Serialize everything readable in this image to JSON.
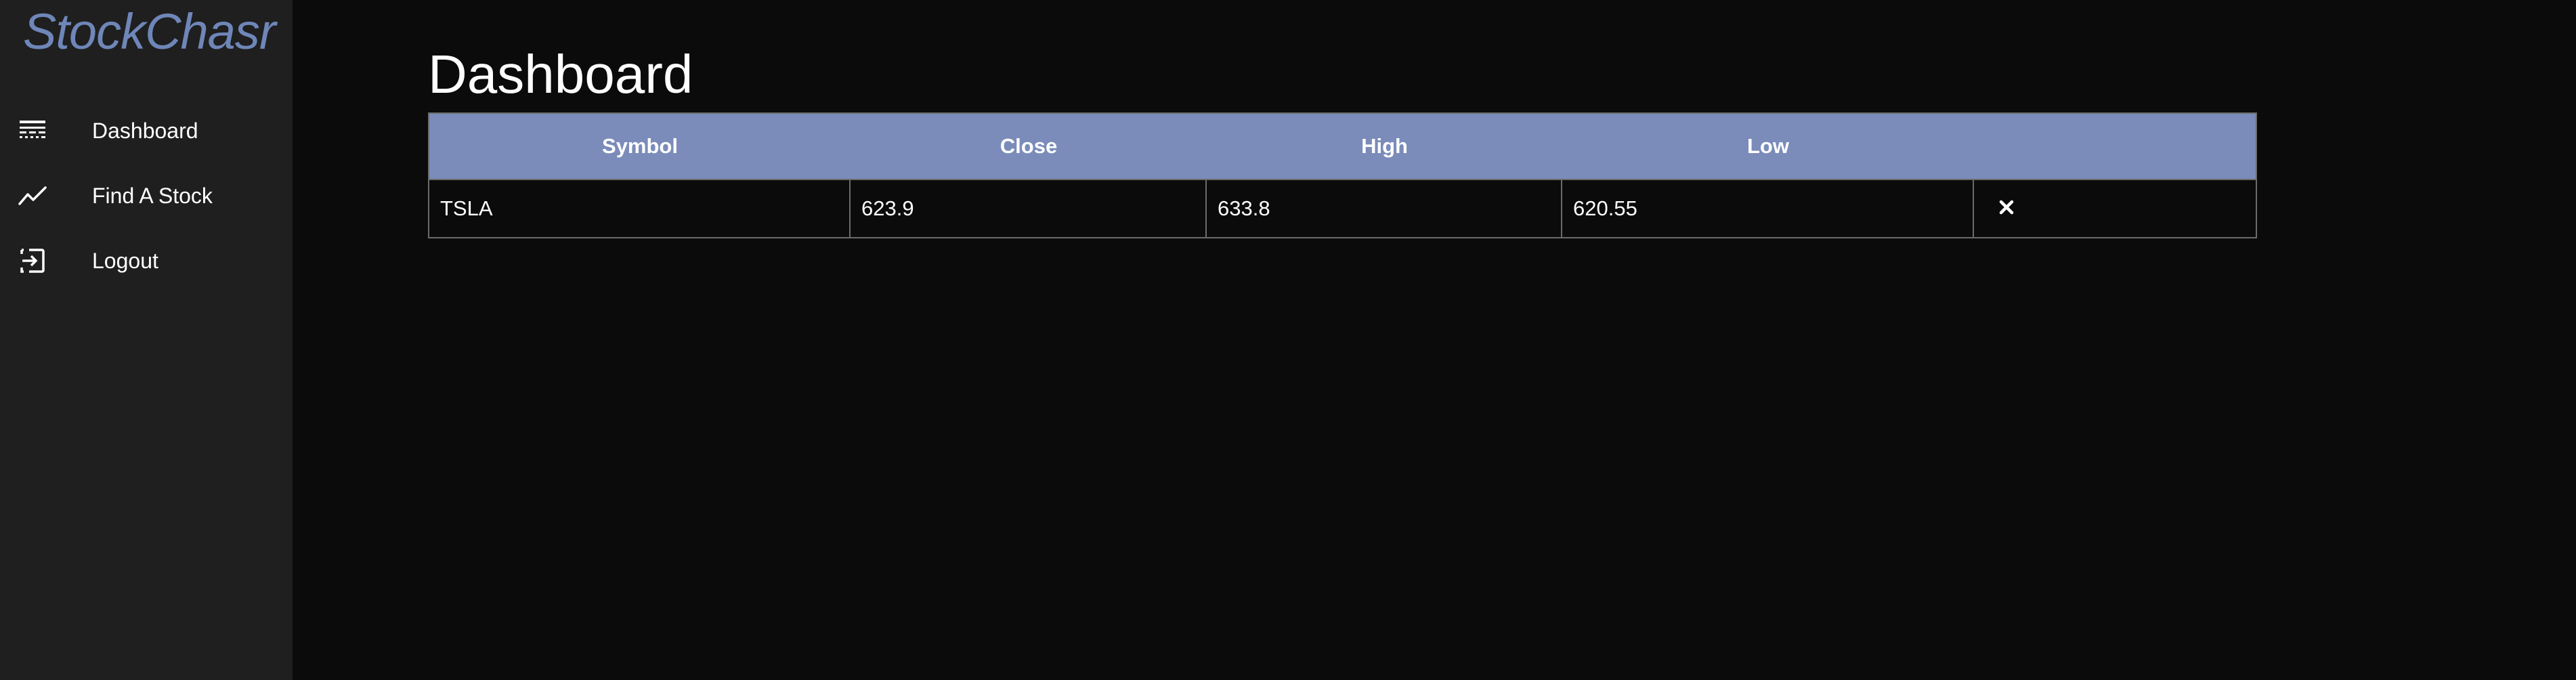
{
  "app": {
    "logo": "StockChasr",
    "accent_color": "#6f86b8",
    "header_color": "#7b8cba"
  },
  "sidebar": {
    "items": [
      {
        "label": "Dashboard",
        "icon": "dashboard-icon"
      },
      {
        "label": "Find A Stock",
        "icon": "trending-up-icon"
      },
      {
        "label": "Logout",
        "icon": "logout-icon"
      }
    ]
  },
  "main": {
    "title": "Dashboard"
  },
  "table": {
    "columns": [
      "Symbol",
      "Close",
      "High",
      "Low",
      ""
    ],
    "rows": [
      {
        "symbol": "TSLA",
        "close": "623.9",
        "high": "633.8",
        "low": "620.55",
        "action_icon": "close-icon"
      }
    ]
  }
}
